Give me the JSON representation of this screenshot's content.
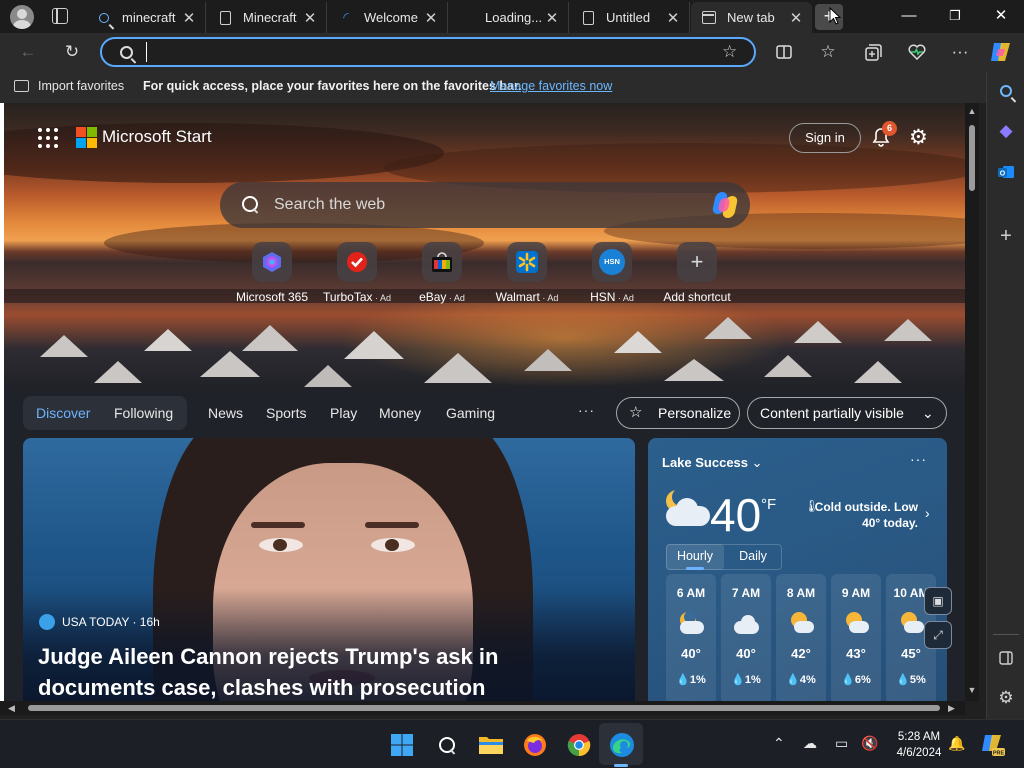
{
  "window": {
    "tabs": [
      {
        "title": "minecraft",
        "icon": "search-icon",
        "active": false
      },
      {
        "title": "Minecraft",
        "icon": "page-icon",
        "active": false
      },
      {
        "title": "Welcome",
        "icon": "loading-icon",
        "active": false
      },
      {
        "title": "Loading...",
        "icon": "none",
        "active": false
      },
      {
        "title": "Untitled",
        "icon": "page-icon",
        "active": false
      },
      {
        "title": "New tab",
        "icon": "newtab-icon",
        "active": true
      }
    ],
    "new_tab_symbol": "+",
    "minimize_symbol": "—",
    "maximize_symbol": "❐",
    "close_symbol": "✕"
  },
  "address_bar": {
    "value": "",
    "placeholder": ""
  },
  "favorites_bar": {
    "import_label": "Import favorites",
    "message": "For quick access, place your favorites here on the favorites bar.",
    "manage_link": "Manage favorites now"
  },
  "ntp": {
    "brand": "Microsoft Start",
    "sign_in": "Sign in",
    "notification_count": "6",
    "search_placeholder": "Search the web",
    "shortcuts": [
      {
        "label": "Microsoft 365",
        "ad": ""
      },
      {
        "label": "TurboTax",
        "ad": " · Ad"
      },
      {
        "label": "eBay",
        "ad": " · Ad"
      },
      {
        "label": "Walmart",
        "ad": " · Ad"
      },
      {
        "label": "HSN",
        "ad": " · Ad"
      },
      {
        "label": "Add shortcut",
        "ad": ""
      }
    ],
    "hsn_badge": "HSN",
    "nav": {
      "discover": "Discover",
      "following": "Following",
      "news": "News",
      "sports": "Sports",
      "play": "Play",
      "money": "Money",
      "gaming": "Gaming",
      "more": "···",
      "personalize": "Personalize",
      "content_visibility": "Content partially visible"
    },
    "story": {
      "source": "USA TODAY · 16h",
      "headline": "Judge Aileen Cannon rejects Trump's ask in documents case, clashes with prosecution"
    },
    "weather": {
      "location": "Lake Success",
      "temperature": "40",
      "unit": "°F",
      "description": "Cold outside. Low 40° today.",
      "tab_hourly": "Hourly",
      "tab_daily": "Daily",
      "hours": [
        {
          "time": "6 AM",
          "temp": "40°",
          "precip": "1%",
          "icon": "partly-cloudy-night-icon"
        },
        {
          "time": "7 AM",
          "temp": "40°",
          "precip": "1%",
          "icon": "cloudy-icon"
        },
        {
          "time": "8 AM",
          "temp": "42°",
          "precip": "4%",
          "icon": "partly-sunny-icon"
        },
        {
          "time": "9 AM",
          "temp": "43°",
          "precip": "6%",
          "icon": "partly-sunny-icon"
        },
        {
          "time": "10 AM",
          "temp": "45°",
          "precip": "5%",
          "icon": "partly-sunny-icon"
        }
      ]
    }
  },
  "taskbar": {
    "time": "5:28 AM",
    "date": "4/6/2024"
  },
  "colors": {
    "accent": "#6db3ff",
    "link": "#6cb8ff",
    "badge": "#e0562e"
  }
}
